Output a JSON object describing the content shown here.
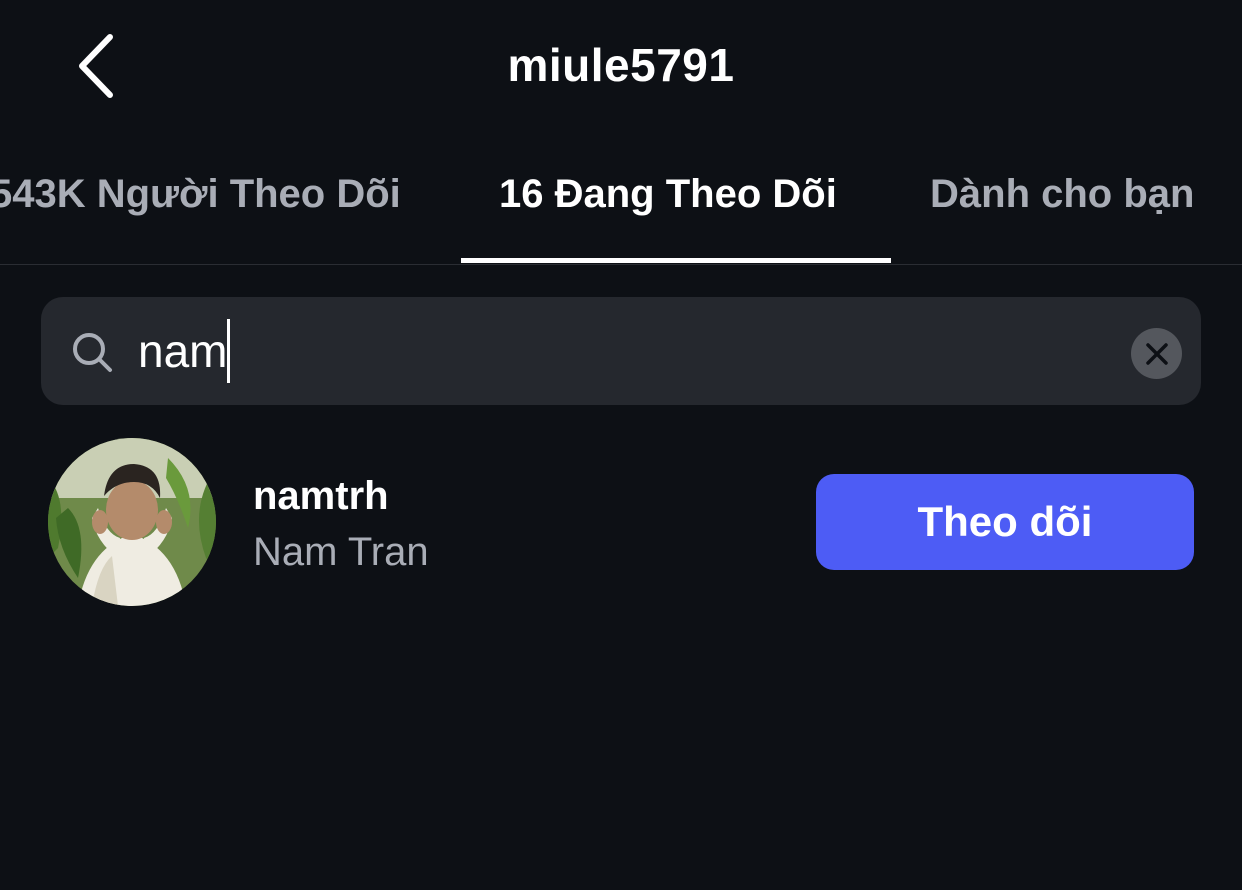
{
  "header": {
    "title": "miule5791"
  },
  "tabs": [
    {
      "label": "543K Người Theo Dõi",
      "active": false
    },
    {
      "label": "16 Đang Theo Dõi",
      "active": true
    },
    {
      "label": "Dành cho bạn",
      "active": false
    }
  ],
  "search": {
    "value": "nam"
  },
  "results": [
    {
      "username": "namtrh",
      "display_name": "Nam Tran",
      "action_label": "Theo dõi"
    }
  ],
  "colors": {
    "background": "#0d1015",
    "search_bg": "#25282e",
    "accent": "#4d5cf5",
    "muted_text": "#a9adb6"
  },
  "icons": {
    "back": "chevron-left-icon",
    "search": "search-icon",
    "clear": "close-icon"
  }
}
